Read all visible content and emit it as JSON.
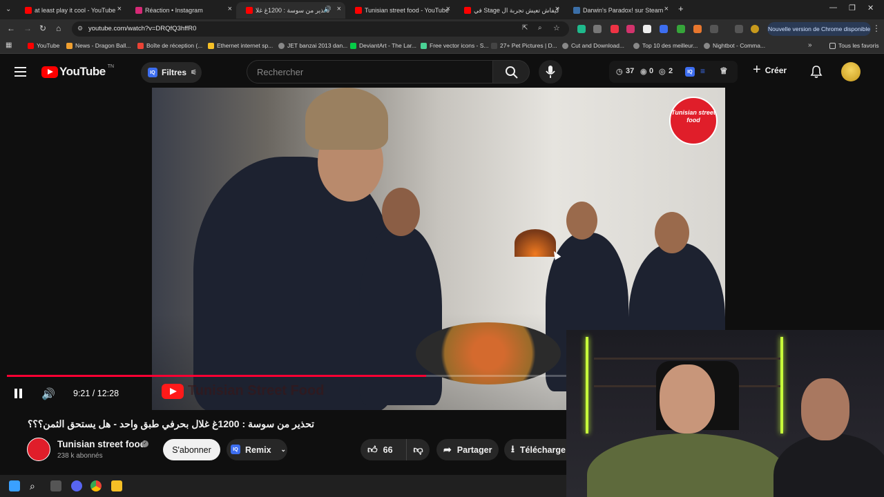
{
  "browser": {
    "tabs": [
      {
        "title": "at least play it cool - YouTube",
        "color": "#ff0000"
      },
      {
        "title": "Réaction • Instagram",
        "color": "#d62976"
      },
      {
        "title": "تحذير من سوسة : 1200غ غلا",
        "color": "#ff0000"
      },
      {
        "title": "Tunisian street food - YouTube",
        "color": "#ff0000"
      },
      {
        "title": "كيفاش تعيش تجربة ال Stage في",
        "color": "#ff0000"
      },
      {
        "title": "Darwin's Paradox! sur Steam",
        "color": "#1b2838"
      }
    ],
    "new_tab": "+",
    "url": "youtube.com/watch?v=DRQfQ3hffR0",
    "update_chip": "Nouvelle version de Chrome disponible",
    "bookmarks": [
      {
        "label": "YouTube",
        "color": "#ff0000"
      },
      {
        "label": "News - Dragon Ball...",
        "color": "#f0a030"
      },
      {
        "label": "Boîte de réception (...",
        "color": "#ea4335"
      },
      {
        "label": "Ethernet internet sp...",
        "color": "#f6c026"
      },
      {
        "label": "JET banzai 2013 dan...",
        "color": "#888888"
      },
      {
        "label": "DeviantArt - The Lar...",
        "color": "#05cc47"
      },
      {
        "label": "Free vector icons - S...",
        "color": "#4ad295"
      },
      {
        "label": "27+ Pet Pictures | D...",
        "color": "#444444"
      },
      {
        "label": "Cut and Download...",
        "color": "#888888"
      },
      {
        "label": "Top 10 des meilleur...",
        "color": "#888888"
      },
      {
        "label": "Nightbot - Comma...",
        "color": "#888888"
      }
    ],
    "all_bookmarks": "Tous les favoris"
  },
  "youtube": {
    "logo": "YouTube",
    "country": "TN",
    "filters": "Filtres",
    "search_placeholder": "Rechercher",
    "stats": {
      "a": "37",
      "b": "0",
      "c": "2"
    },
    "create": "Créer"
  },
  "video": {
    "overlay_logo": "Tunisian street food",
    "watermark": "Tunisian Street Food",
    "time": "9:21 / 12:28",
    "progress": 0.749,
    "title": "تحذير من سوسة : 1200غ غلال بحرفي طبق واحد - هل يستحق الثمن؟؟؟",
    "channel": "Tunisian street food",
    "subscribers": "238 k abonnés",
    "subscribe": "S'abonner",
    "remix": "Remix",
    "likes": "66",
    "share": "Partager",
    "download": "Télécharge"
  },
  "colors": {
    "accent": "#ff0000",
    "progress": "#ff0033"
  }
}
